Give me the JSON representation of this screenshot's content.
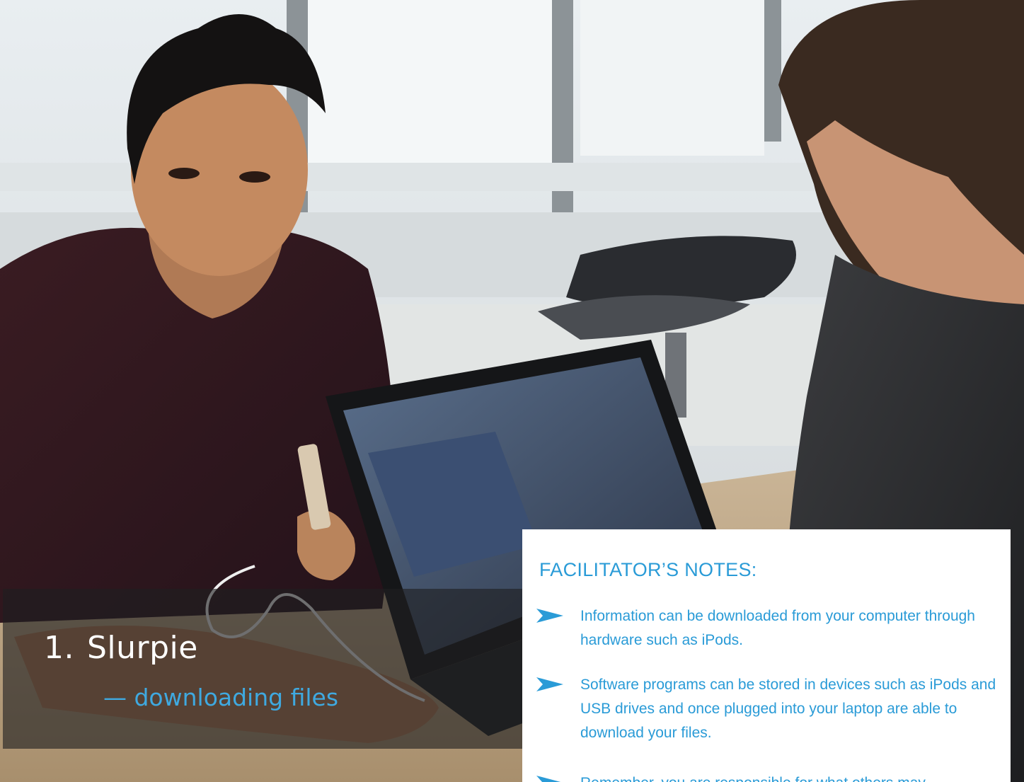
{
  "slide": {
    "number": "1.",
    "title": "Slurpie",
    "subtitle": "— downloading files"
  },
  "notes": {
    "heading": "FACILITATOR’S NOTES:",
    "items": [
      "Information can be downloaded from your computer through hardware such as iPods.",
      "Software programs can be stored in devices such as iPods and USB drives and once plugged into your laptop are able to download your files.",
      "Remember, you are responsible for what others may"
    ]
  },
  "colors": {
    "accent": "#2a9bd7",
    "subtitle": "#3fa9e0",
    "panel": "#ffffff",
    "band": "#1e1e20"
  }
}
